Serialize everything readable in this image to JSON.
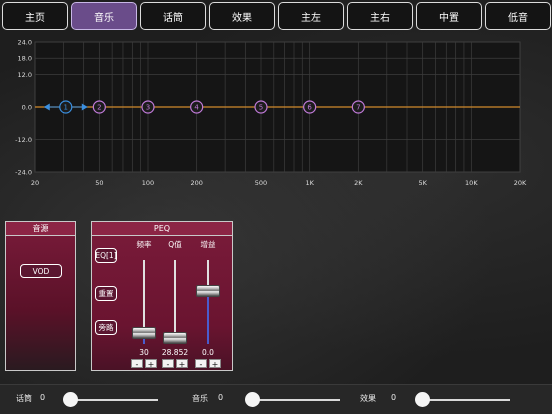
{
  "tabs": [
    {
      "label": "主页",
      "active": false
    },
    {
      "label": "音乐",
      "active": true
    },
    {
      "label": "话筒",
      "active": false
    },
    {
      "label": "效果",
      "active": false
    },
    {
      "label": "主左",
      "active": false
    },
    {
      "label": "主右",
      "active": false
    },
    {
      "label": "中置",
      "active": false
    },
    {
      "label": "低音",
      "active": false
    }
  ],
  "eq": {
    "y_ticks": [
      "24.0",
      "18.0",
      "12.0",
      "0.0",
      "-12.0",
      "-24.0"
    ],
    "x_ticks": [
      "20",
      "50",
      "100",
      "200",
      "500",
      "1K",
      "2K",
      "5K",
      "10K",
      "20K"
    ],
    "bands": [
      {
        "label": "1",
        "freq": 31,
        "gain": 0,
        "selected": true
      },
      {
        "label": "2",
        "freq": 50,
        "gain": 0
      },
      {
        "label": "3",
        "freq": 100,
        "gain": 0
      },
      {
        "label": "4",
        "freq": 200,
        "gain": 0
      },
      {
        "label": "5",
        "freq": 500,
        "gain": 0
      },
      {
        "label": "6",
        "freq": 1000,
        "gain": 0
      },
      {
        "label": "7",
        "freq": 2000,
        "gain": 0
      }
    ],
    "colors": {
      "curve": "#d08a2c",
      "band": "#c07ad8",
      "selected": "#3a8fe0"
    }
  },
  "source_panel": {
    "title": "音源",
    "vod_label": "VOD"
  },
  "peq_panel": {
    "title": "PEQ",
    "eq_label": "EQ[1]",
    "reset_label": "重置",
    "bypass_label": "旁路",
    "freq_label": "频率",
    "q_label": "Q值",
    "gain_label": "增益",
    "freq_value": "30",
    "q_value": "28.852",
    "gain_value": "0.0",
    "minus": "-",
    "plus": "+"
  },
  "footer": {
    "mic_label": "话筒",
    "mic_value": "0",
    "music_label": "音乐",
    "music_value": "0",
    "effect_label": "效果",
    "effect_value": "0"
  }
}
